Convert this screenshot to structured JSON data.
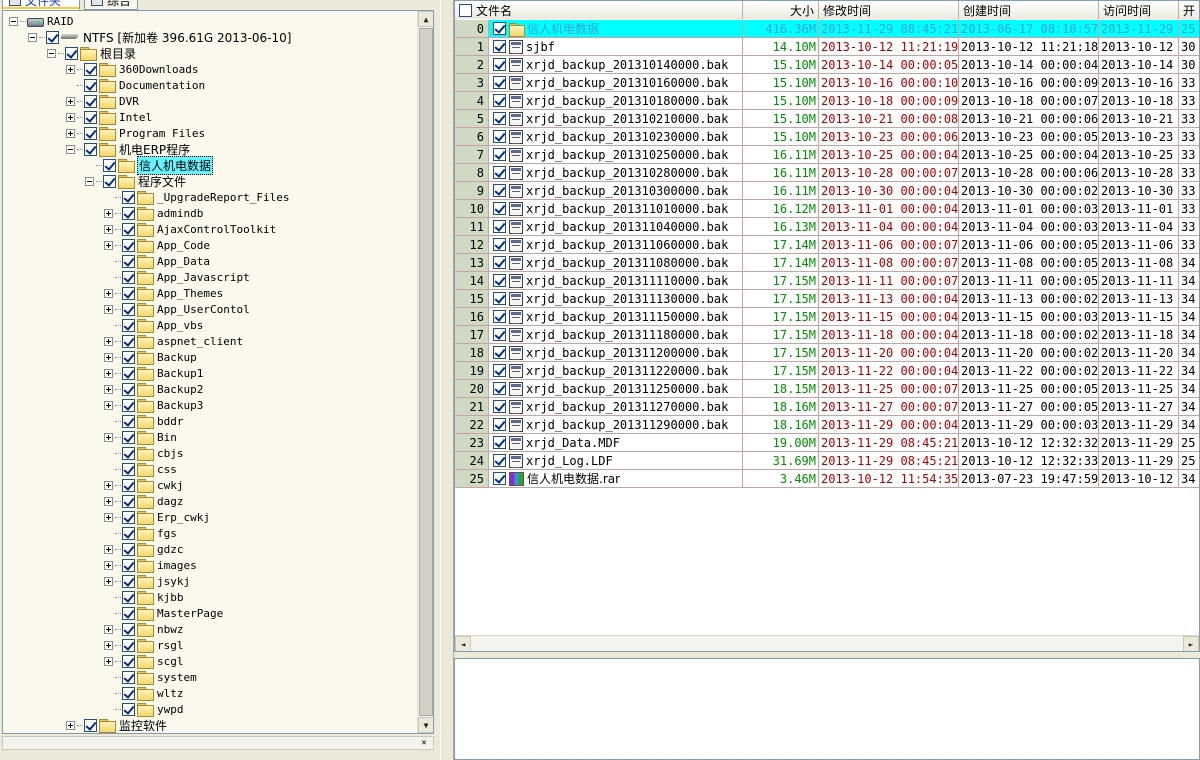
{
  "tabs": [
    {
      "label": "文件夹",
      "icon": "folder-tab-icon",
      "active": true
    },
    {
      "label": "综合",
      "icon": "summary-tab-icon",
      "active": false
    }
  ],
  "tree": [
    {
      "label": "RAID",
      "level": 0,
      "expander": "minus",
      "icon": "drive",
      "checkbox": false
    },
    {
      "label": "NTFS [新加卷 396.61G 2013-06-10]",
      "level": 1,
      "expander": "minus",
      "icon": "hdd",
      "checkbox": true
    },
    {
      "label": "根目录",
      "level": 2,
      "expander": "minus",
      "icon": "folder",
      "checkbox": true
    },
    {
      "label": "360Downloads",
      "level": 3,
      "expander": "plus",
      "icon": "folder",
      "checkbox": true
    },
    {
      "label": "Documentation",
      "level": 3,
      "expander": "none",
      "icon": "folder",
      "checkbox": true
    },
    {
      "label": "DVR",
      "level": 3,
      "expander": "plus",
      "icon": "folder",
      "checkbox": true
    },
    {
      "label": "Intel",
      "level": 3,
      "expander": "plus",
      "icon": "folder",
      "checkbox": true
    },
    {
      "label": "Program Files",
      "level": 3,
      "expander": "plus",
      "icon": "folder",
      "checkbox": true
    },
    {
      "label": "机电ERP程序",
      "level": 3,
      "expander": "minus",
      "icon": "folder",
      "checkbox": true
    },
    {
      "label": "信人机电数据",
      "level": 4,
      "expander": "none",
      "icon": "folder",
      "checkbox": true,
      "selected": true
    },
    {
      "label": "程序文件",
      "level": 4,
      "expander": "minus",
      "icon": "folder",
      "checkbox": true
    },
    {
      "label": "_UpgradeReport_Files",
      "level": 5,
      "expander": "none",
      "icon": "folder",
      "checkbox": true
    },
    {
      "label": "admindb",
      "level": 5,
      "expander": "plus",
      "icon": "folder",
      "checkbox": true
    },
    {
      "label": "AjaxControlToolkit",
      "level": 5,
      "expander": "plus",
      "icon": "folder",
      "checkbox": true
    },
    {
      "label": "App_Code",
      "level": 5,
      "expander": "plus",
      "icon": "folder",
      "checkbox": true
    },
    {
      "label": "App_Data",
      "level": 5,
      "expander": "none",
      "icon": "folder",
      "checkbox": true
    },
    {
      "label": "App_Javascript",
      "level": 5,
      "expander": "none",
      "icon": "folder",
      "checkbox": true
    },
    {
      "label": "App_Themes",
      "level": 5,
      "expander": "plus",
      "icon": "folder",
      "checkbox": true
    },
    {
      "label": "App_UserContol",
      "level": 5,
      "expander": "plus",
      "icon": "folder",
      "checkbox": true
    },
    {
      "label": "App_vbs",
      "level": 5,
      "expander": "none",
      "icon": "folder",
      "checkbox": true
    },
    {
      "label": "aspnet_client",
      "level": 5,
      "expander": "plus",
      "icon": "folder",
      "checkbox": true
    },
    {
      "label": "Backup",
      "level": 5,
      "expander": "plus",
      "icon": "folder",
      "checkbox": true
    },
    {
      "label": "Backup1",
      "level": 5,
      "expander": "plus",
      "icon": "folder",
      "checkbox": true
    },
    {
      "label": "Backup2",
      "level": 5,
      "expander": "plus",
      "icon": "folder",
      "checkbox": true
    },
    {
      "label": "Backup3",
      "level": 5,
      "expander": "plus",
      "icon": "folder",
      "checkbox": true
    },
    {
      "label": "bddr",
      "level": 5,
      "expander": "none",
      "icon": "folder",
      "checkbox": true
    },
    {
      "label": "Bin",
      "level": 5,
      "expander": "plus",
      "icon": "folder",
      "checkbox": true
    },
    {
      "label": "cbjs",
      "level": 5,
      "expander": "none",
      "icon": "folder",
      "checkbox": true
    },
    {
      "label": "css",
      "level": 5,
      "expander": "none",
      "icon": "folder",
      "checkbox": true
    },
    {
      "label": "cwkj",
      "level": 5,
      "expander": "plus",
      "icon": "folder",
      "checkbox": true
    },
    {
      "label": "dagz",
      "level": 5,
      "expander": "plus",
      "icon": "folder",
      "checkbox": true
    },
    {
      "label": "Erp_cwkj",
      "level": 5,
      "expander": "plus",
      "icon": "folder",
      "checkbox": true
    },
    {
      "label": "fgs",
      "level": 5,
      "expander": "none",
      "icon": "folder",
      "checkbox": true
    },
    {
      "label": "gdzc",
      "level": 5,
      "expander": "plus",
      "icon": "folder",
      "checkbox": true
    },
    {
      "label": "images",
      "level": 5,
      "expander": "plus",
      "icon": "folder",
      "checkbox": true
    },
    {
      "label": "jsykj",
      "level": 5,
      "expander": "plus",
      "icon": "folder",
      "checkbox": true
    },
    {
      "label": "kjbb",
      "level": 5,
      "expander": "none",
      "icon": "folder",
      "checkbox": true
    },
    {
      "label": "MasterPage",
      "level": 5,
      "expander": "none",
      "icon": "folder",
      "checkbox": true
    },
    {
      "label": "nbwz",
      "level": 5,
      "expander": "plus",
      "icon": "folder",
      "checkbox": true
    },
    {
      "label": "rsgl",
      "level": 5,
      "expander": "plus",
      "icon": "folder",
      "checkbox": true
    },
    {
      "label": "scgl",
      "level": 5,
      "expander": "plus",
      "icon": "folder",
      "checkbox": true
    },
    {
      "label": "system",
      "level": 5,
      "expander": "none",
      "icon": "folder",
      "checkbox": true
    },
    {
      "label": "wltz",
      "level": 5,
      "expander": "none",
      "icon": "folder",
      "checkbox": true
    },
    {
      "label": "ywpd",
      "level": 5,
      "expander": "none",
      "icon": "folder",
      "checkbox": true
    },
    {
      "label": "监控软件",
      "level": 3,
      "expander": "plus",
      "icon": "folder",
      "checkbox": true
    }
  ],
  "list": {
    "columns": [
      "文件名",
      "大小",
      "修改时间",
      "创建时间",
      "访问时间",
      "开"
    ],
    "rows": [
      {
        "idx": "0",
        "name": "信人机电数据",
        "icon": "folder",
        "size": "416.36M",
        "modified": "2013-11-29 08:45:21",
        "created": "2013-06-17 08:10:57",
        "accessed": "2013-11-29",
        "extra": "25",
        "highlight": true
      },
      {
        "idx": "1",
        "name": "sjbf",
        "icon": "file",
        "size": "14.10M",
        "modified": "2013-10-12 11:21:19",
        "created": "2013-10-12 11:21:18",
        "accessed": "2013-10-12",
        "extra": "30"
      },
      {
        "idx": "2",
        "name": "xrjd_backup_201310140000.bak",
        "icon": "file",
        "size": "15.10M",
        "modified": "2013-10-14 00:00:05",
        "created": "2013-10-14 00:00:04",
        "accessed": "2013-10-14",
        "extra": "30"
      },
      {
        "idx": "3",
        "name": "xrjd_backup_201310160000.bak",
        "icon": "file",
        "size": "15.10M",
        "modified": "2013-10-16 00:00:10",
        "created": "2013-10-16 00:00:09",
        "accessed": "2013-10-16",
        "extra": "33"
      },
      {
        "idx": "4",
        "name": "xrjd_backup_201310180000.bak",
        "icon": "file",
        "size": "15.10M",
        "modified": "2013-10-18 00:00:09",
        "created": "2013-10-18 00:00:07",
        "accessed": "2013-10-18",
        "extra": "33"
      },
      {
        "idx": "5",
        "name": "xrjd_backup_201310210000.bak",
        "icon": "file",
        "size": "15.10M",
        "modified": "2013-10-21 00:00:08",
        "created": "2013-10-21 00:00:06",
        "accessed": "2013-10-21",
        "extra": "33"
      },
      {
        "idx": "6",
        "name": "xrjd_backup_201310230000.bak",
        "icon": "file",
        "size": "15.10M",
        "modified": "2013-10-23 00:00:06",
        "created": "2013-10-23 00:00:05",
        "accessed": "2013-10-23",
        "extra": "33"
      },
      {
        "idx": "7",
        "name": "xrjd_backup_201310250000.bak",
        "icon": "file",
        "size": "16.11M",
        "modified": "2013-10-25 00:00:04",
        "created": "2013-10-25 00:00:04",
        "accessed": "2013-10-25",
        "extra": "33"
      },
      {
        "idx": "8",
        "name": "xrjd_backup_201310280000.bak",
        "icon": "file",
        "size": "16.11M",
        "modified": "2013-10-28 00:00:07",
        "created": "2013-10-28 00:00:06",
        "accessed": "2013-10-28",
        "extra": "33"
      },
      {
        "idx": "9",
        "name": "xrjd_backup_201310300000.bak",
        "icon": "file",
        "size": "16.11M",
        "modified": "2013-10-30 00:00:04",
        "created": "2013-10-30 00:00:02",
        "accessed": "2013-10-30",
        "extra": "33"
      },
      {
        "idx": "10",
        "name": "xrjd_backup_201311010000.bak",
        "icon": "file",
        "size": "16.12M",
        "modified": "2013-11-01 00:00:04",
        "created": "2013-11-01 00:00:03",
        "accessed": "2013-11-01",
        "extra": "33"
      },
      {
        "idx": "11",
        "name": "xrjd_backup_201311040000.bak",
        "icon": "file",
        "size": "16.13M",
        "modified": "2013-11-04 00:00:04",
        "created": "2013-11-04 00:00:03",
        "accessed": "2013-11-04",
        "extra": "33"
      },
      {
        "idx": "12",
        "name": "xrjd_backup_201311060000.bak",
        "icon": "file",
        "size": "17.14M",
        "modified": "2013-11-06 00:00:07",
        "created": "2013-11-06 00:00:05",
        "accessed": "2013-11-06",
        "extra": "33"
      },
      {
        "idx": "13",
        "name": "xrjd_backup_201311080000.bak",
        "icon": "file",
        "size": "17.14M",
        "modified": "2013-11-08 00:00:07",
        "created": "2013-11-08 00:00:05",
        "accessed": "2013-11-08",
        "extra": "34"
      },
      {
        "idx": "14",
        "name": "xrjd_backup_201311110000.bak",
        "icon": "file",
        "size": "17.15M",
        "modified": "2013-11-11 00:00:07",
        "created": "2013-11-11 00:00:05",
        "accessed": "2013-11-11",
        "extra": "34"
      },
      {
        "idx": "15",
        "name": "xrjd_backup_201311130000.bak",
        "icon": "file",
        "size": "17.15M",
        "modified": "2013-11-13 00:00:04",
        "created": "2013-11-13 00:00:02",
        "accessed": "2013-11-13",
        "extra": "34"
      },
      {
        "idx": "16",
        "name": "xrjd_backup_201311150000.bak",
        "icon": "file",
        "size": "17.15M",
        "modified": "2013-11-15 00:00:04",
        "created": "2013-11-15 00:00:03",
        "accessed": "2013-11-15",
        "extra": "34"
      },
      {
        "idx": "17",
        "name": "xrjd_backup_201311180000.bak",
        "icon": "file",
        "size": "17.15M",
        "modified": "2013-11-18 00:00:04",
        "created": "2013-11-18 00:00:02",
        "accessed": "2013-11-18",
        "extra": "34"
      },
      {
        "idx": "18",
        "name": "xrjd_backup_201311200000.bak",
        "icon": "file",
        "size": "17.15M",
        "modified": "2013-11-20 00:00:04",
        "created": "2013-11-20 00:00:02",
        "accessed": "2013-11-20",
        "extra": "34"
      },
      {
        "idx": "19",
        "name": "xrjd_backup_201311220000.bak",
        "icon": "file",
        "size": "17.15M",
        "modified": "2013-11-22 00:00:04",
        "created": "2013-11-22 00:00:02",
        "accessed": "2013-11-22",
        "extra": "34"
      },
      {
        "idx": "20",
        "name": "xrjd_backup_201311250000.bak",
        "icon": "file",
        "size": "18.15M",
        "modified": "2013-11-25 00:00:07",
        "created": "2013-11-25 00:00:05",
        "accessed": "2013-11-25",
        "extra": "34"
      },
      {
        "idx": "21",
        "name": "xrjd_backup_201311270000.bak",
        "icon": "file",
        "size": "18.16M",
        "modified": "2013-11-27 00:00:07",
        "created": "2013-11-27 00:00:05",
        "accessed": "2013-11-27",
        "extra": "34"
      },
      {
        "idx": "22",
        "name": "xrjd_backup_201311290000.bak",
        "icon": "file",
        "size": "18.16M",
        "modified": "2013-11-29 00:00:04",
        "created": "2013-11-29 00:00:03",
        "accessed": "2013-11-29",
        "extra": "34"
      },
      {
        "idx": "23",
        "name": "xrjd_Data.MDF",
        "icon": "file",
        "size": "19.00M",
        "modified": "2013-11-29 08:45:21",
        "created": "2013-10-12 12:32:32",
        "accessed": "2013-11-29",
        "extra": "25"
      },
      {
        "idx": "24",
        "name": "xrjd_Log.LDF",
        "icon": "file",
        "size": "31.69M",
        "modified": "2013-11-29 08:45:21",
        "created": "2013-10-12 12:32:33",
        "accessed": "2013-11-29",
        "extra": "25"
      },
      {
        "idx": "25",
        "name": "信人机电数据.rar",
        "icon": "rar",
        "size": "3.46M",
        "modified": "2013-10-12 11:54:35",
        "created": "2013-07-23 19:47:59",
        "accessed": "2013-10-12",
        "extra": "34"
      }
    ]
  },
  "scroll": {
    "up": "▲",
    "down": "▼",
    "left": "◄",
    "right": "►",
    "close": "✕"
  },
  "colors": {
    "highlight": "#00ffff",
    "size_text": "#009000",
    "modified_text": "#b00000",
    "selected_tree": "#66f3ff"
  }
}
